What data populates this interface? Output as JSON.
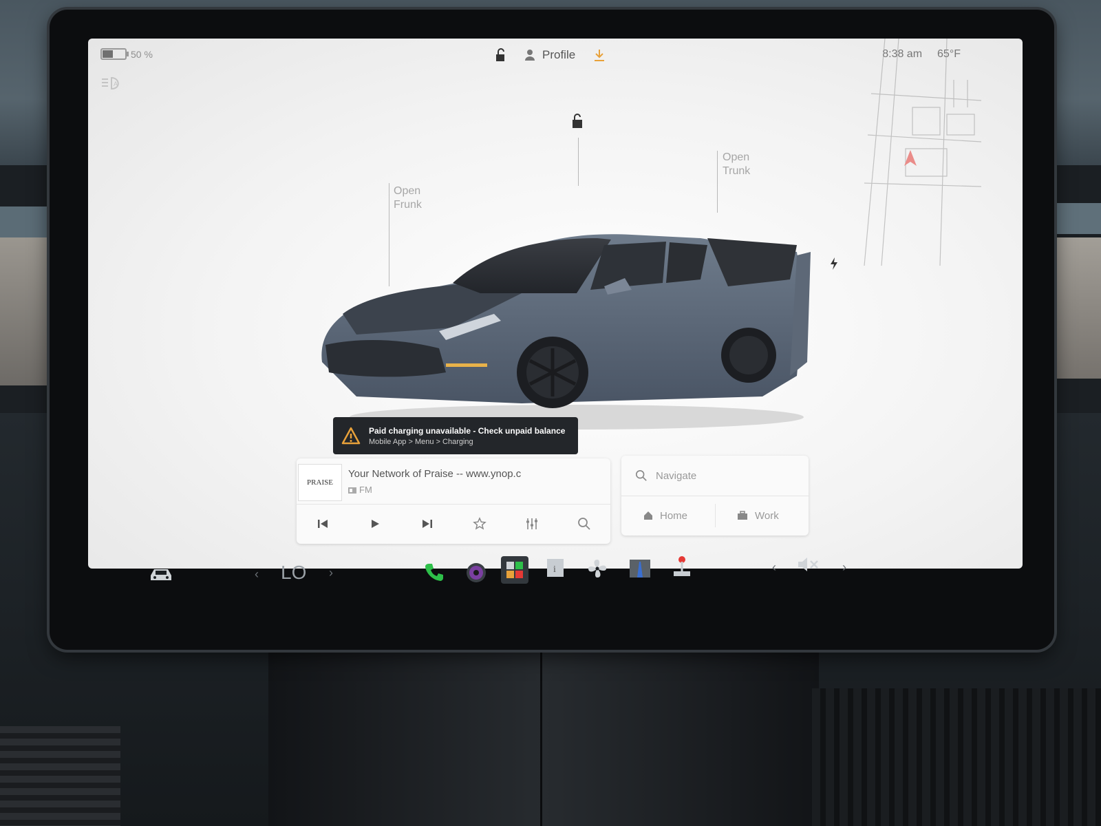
{
  "status": {
    "battery_percent": "50 %",
    "battery_level": 0.5,
    "time": "8:38 am",
    "temperature": "65°F",
    "profile_label": "Profile"
  },
  "vehicle": {
    "frunk_label_1": "Open",
    "frunk_label_2": "Frunk",
    "trunk_label_1": "Open",
    "trunk_label_2": "Trunk"
  },
  "alert": {
    "title": "Paid charging unavailable - Check unpaid balance",
    "subtitle": "Mobile App > Menu > Charging"
  },
  "media": {
    "logo_text": "PRAISE",
    "station": "Your Network of Praise -- www.ynop.c",
    "band": "FM"
  },
  "navigation": {
    "placeholder": "Navigate",
    "home_label": "Home",
    "work_label": "Work"
  },
  "taskbar": {
    "climate_label": "LO"
  },
  "colors": {
    "accent_orange": "#e8a13a",
    "phone_green": "#2ec04a",
    "camera_purple": "#7a3fa0",
    "alert_bg": "#23262a",
    "nav_arrow_red": "#e53935"
  }
}
